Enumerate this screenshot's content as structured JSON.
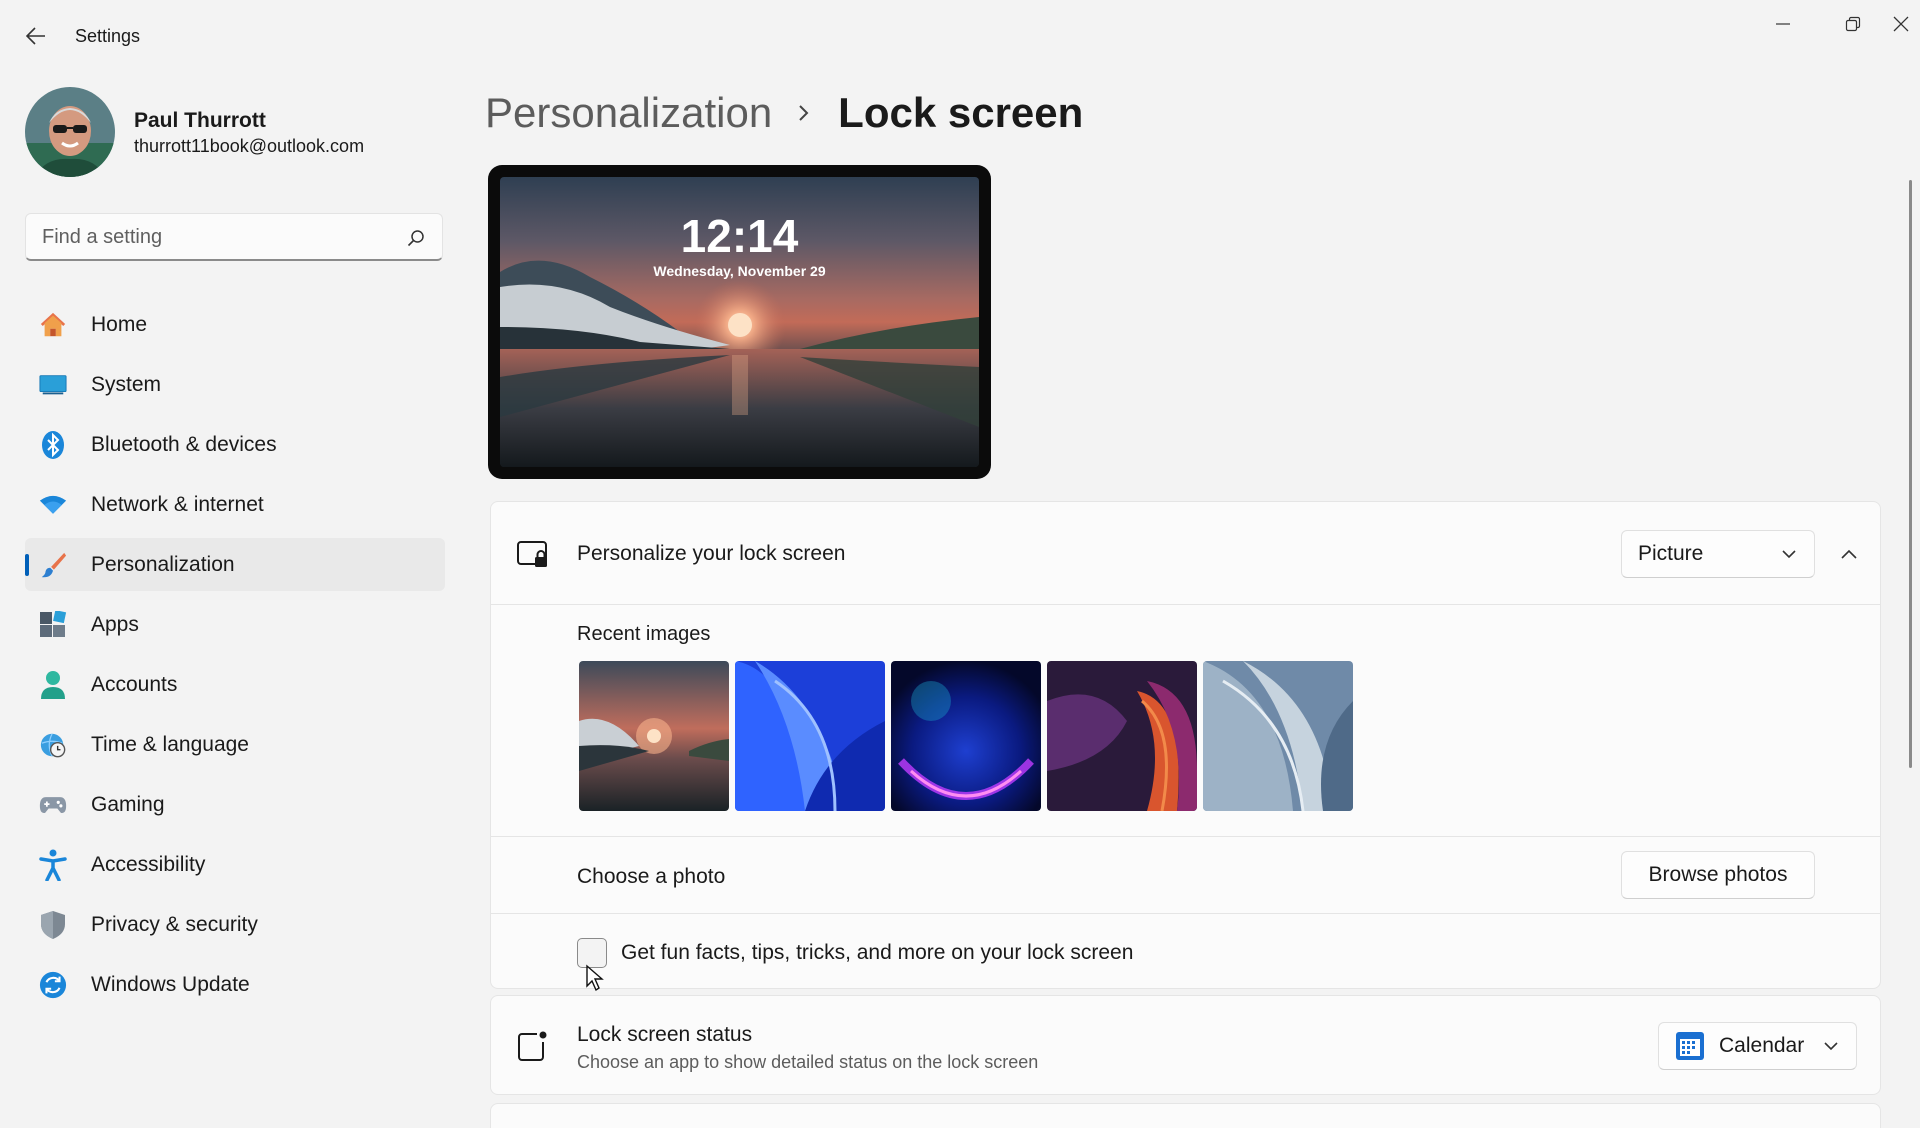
{
  "window": {
    "title": "Settings",
    "back_icon": "back-arrow-icon",
    "controls": [
      "minimize-icon",
      "restore-icon",
      "close-icon"
    ]
  },
  "profile": {
    "name": "Paul Thurrott",
    "email": "thurrott11book@outlook.com"
  },
  "search": {
    "placeholder": "Find a setting",
    "value": ""
  },
  "sidebar": {
    "items": [
      {
        "label": "Home",
        "icon": "home-icon",
        "active": false
      },
      {
        "label": "System",
        "icon": "system-icon",
        "active": false
      },
      {
        "label": "Bluetooth & devices",
        "icon": "bluetooth-icon",
        "active": false
      },
      {
        "label": "Network & internet",
        "icon": "wifi-icon",
        "active": false
      },
      {
        "label": "Personalization",
        "icon": "paintbrush-icon",
        "active": true
      },
      {
        "label": "Apps",
        "icon": "apps-icon",
        "active": false
      },
      {
        "label": "Accounts",
        "icon": "accounts-icon",
        "active": false
      },
      {
        "label": "Time & language",
        "icon": "globe-clock-icon",
        "active": false
      },
      {
        "label": "Gaming",
        "icon": "gamepad-icon",
        "active": false
      },
      {
        "label": "Accessibility",
        "icon": "accessibility-icon",
        "active": false
      },
      {
        "label": "Privacy & security",
        "icon": "shield-icon",
        "active": false
      },
      {
        "label": "Windows Update",
        "icon": "update-icon",
        "active": false
      }
    ]
  },
  "breadcrumb": {
    "parent": "Personalization",
    "current": "Lock screen"
  },
  "preview": {
    "time": "12:14",
    "date": "Wednesday, November 29"
  },
  "personalize": {
    "title": "Personalize your lock screen",
    "dropdown_value": "Picture",
    "recent_images_label": "Recent images",
    "recent_images": [
      "sunset-lake-image",
      "blue-bloom-image",
      "glow-orb-image",
      "purple-ribbon-image",
      "silver-bloom-image"
    ],
    "choose_photo_label": "Choose a photo",
    "browse_button": "Browse photos",
    "fun_facts_label": "Get fun facts, tips, tricks, and more on your lock screen",
    "fun_facts_checked": false
  },
  "status": {
    "title": "Lock screen status",
    "subtitle": "Choose an app to show detailed status on the lock screen",
    "dropdown_value": "Calendar"
  },
  "colors": {
    "accent": "#005fb8",
    "window_bg": "#f3f3f3",
    "card_bg": "#fbfbfb"
  }
}
